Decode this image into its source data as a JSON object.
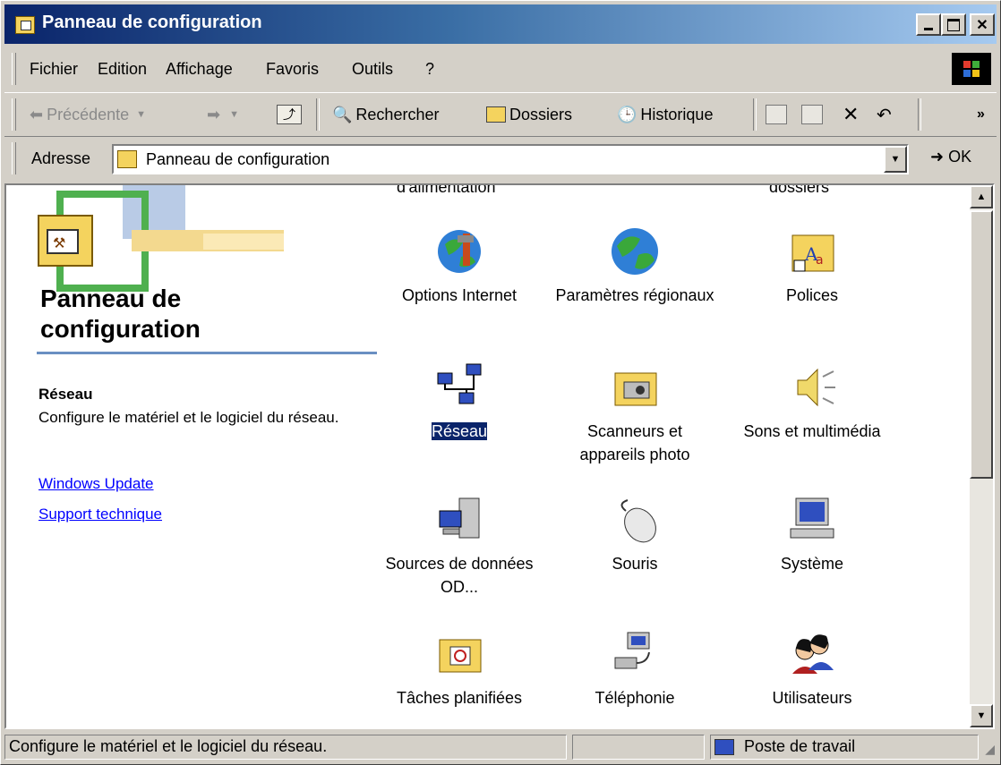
{
  "window": {
    "title": "Panneau de configuration"
  },
  "menu": {
    "items": [
      "Fichier",
      "Edition",
      "Affichage",
      "Favoris",
      "Outils",
      "?"
    ]
  },
  "toolbar": {
    "back_label": "Précédente",
    "search_label": "Rechercher",
    "folders_label": "Dossiers",
    "history_label": "Historique"
  },
  "address": {
    "label": "Adresse",
    "value": "Panneau de configuration",
    "go_label": "OK"
  },
  "leftpane": {
    "title_line1": "Panneau de",
    "title_line2": "configuration",
    "selected_name": "Réseau",
    "selected_desc": "Configure le matériel et le logiciel du réseau.",
    "links": [
      "Windows Update",
      "Support technique"
    ]
  },
  "items": {
    "cut_left": "d'alimentation",
    "cut_right": "dossiers",
    "options_internet": "Options Internet",
    "parametres_regionaux": "Paramètres régionaux",
    "polices": "Polices",
    "reseau": "Réseau",
    "scanneurs": "Scanneurs et appareils photo",
    "sons": "Sons et multimédia",
    "sources": "Sources de données OD...",
    "souris": "Souris",
    "systeme": "Système",
    "taches": "Tâches planifiées",
    "telephonie": "Téléphonie",
    "utilisateurs": "Utilisateurs"
  },
  "status": {
    "message": "Configure le matériel et le logiciel du réseau.",
    "zone": "Poste de travail"
  }
}
